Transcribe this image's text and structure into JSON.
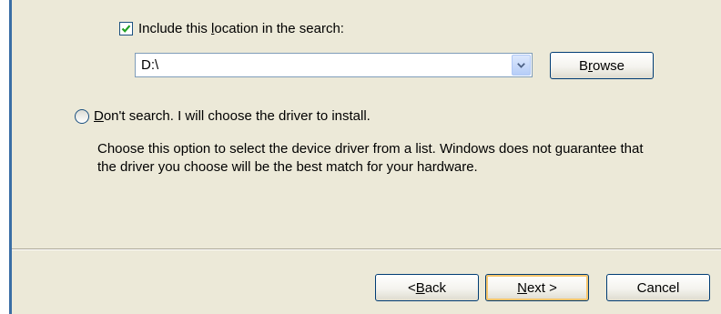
{
  "include_location": {
    "checked": true,
    "label_before": "Include this ",
    "label_mnemonic": "l",
    "label_after": "ocation in the search:"
  },
  "location_combo": {
    "value": "D:\\"
  },
  "browse_button": {
    "before": "B",
    "mnemonic": "r",
    "after": "owse"
  },
  "dont_search": {
    "selected": false,
    "mnemonic": "D",
    "label_after": "on't search. I will choose the driver to install."
  },
  "description": {
    "line1": "Choose this option to select the device driver from a list.  Windows does not guarantee that",
    "line2": "the driver you choose will be the best match for your hardware."
  },
  "buttons": {
    "back": {
      "before": "< ",
      "mnemonic": "B",
      "after": "ack"
    },
    "next": {
      "before": "",
      "mnemonic": "N",
      "after": "ext >"
    },
    "cancel": "Cancel"
  },
  "colors": {
    "dialog_bg": "#ece9d8",
    "checkmark": "#21a121",
    "button_border": "#003c74",
    "default_focus": "#f6c56c",
    "accent_bar": "#3a6ea5"
  }
}
